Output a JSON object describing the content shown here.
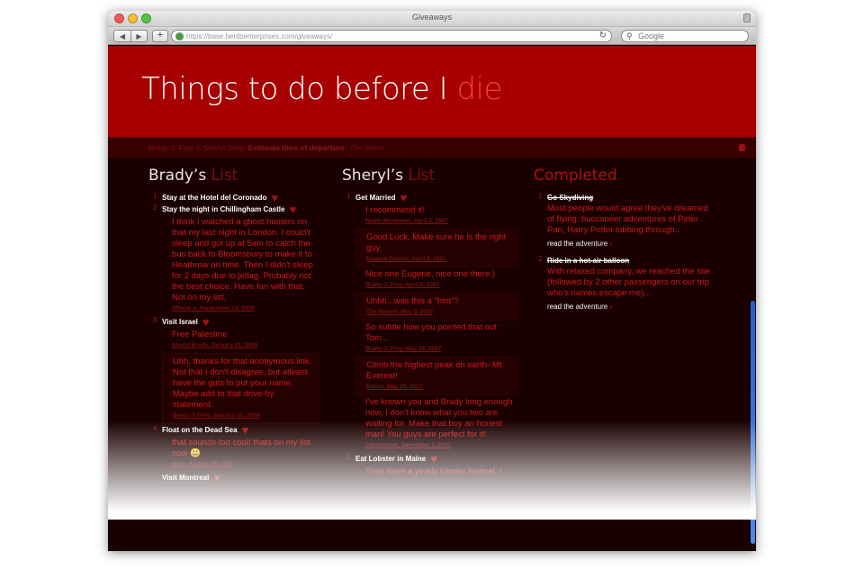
{
  "browser": {
    "window_title": "Giveaways",
    "back": "◀",
    "forward": "▶",
    "add": "+",
    "url": "https://base.bentbenterprises.com/giveaways/",
    "reload": "↻",
    "search_placeholder": "Google"
  },
  "header": {
    "title": "Things to do before I ",
    "title_highlight": "die"
  },
  "subbar": {
    "names": "Brady J. Frey & Sheryl Jang.",
    "label": "Estimate time of departure:",
    "value": "70+ Years"
  },
  "brady": {
    "heading": "Brady’s ",
    "heading_dim": "List",
    "items": [
      {
        "num": "1",
        "title": "Stay at the Hotel del Coronado",
        "comments": []
      },
      {
        "num": "2",
        "title": "Stay the night in Chillingham Castle",
        "comments": [
          {
            "text": "I think I watched a ghost hunters on that my last night in London. I could't sleep and got up at 5am to catch the bus back to Bloomsbury to make it to Heathrow on time. Then I didn't sleep for 2 days due to jetlag. Probably not the best choice. Have fun with that. Not on my list.",
            "meta": "tiffanie o, September 14, 2009",
            "boxed": false
          }
        ]
      },
      {
        "num": "3",
        "title": "Visit Israel",
        "comments": [
          {
            "text": "Free Palestine",
            "meta": "Sheryl Brady, January 31, 2009",
            "boxed": false
          },
          {
            "text": "Uhh, thanks for that anonymous link. Not that I don't disagree, but atleast have the guts to put your name. Maybe add to that drive-by statement.",
            "meta": "Brady J. Frey, January 31, 2009",
            "boxed": true
          }
        ]
      },
      {
        "num": "4",
        "title": "Float on the Dead Sea",
        "comments": [
          {
            "text": "that sounds too cool! thats on my list now 😃",
            "meta": "anna, August 30, 2010",
            "boxed": false
          }
        ]
      },
      {
        "num": "",
        "title": "Visit Montreal",
        "comments": []
      }
    ]
  },
  "sheryl": {
    "heading": "Sheryl’s ",
    "heading_dim": "List",
    "items": [
      {
        "num": "1",
        "title": "Get Married",
        "comments": [
          {
            "text": "I recommend it!",
            "meta": "Noam Birnbaum, April 3, 2007",
            "boxed": false
          },
          {
            "text": "Good Luck, Make sure he is the right guy.",
            "meta": "Eugene Santos, April 4, 2007",
            "boxed": true
          },
          {
            "text": "Nice one Eugene, nice one there.)",
            "meta": "Brady J. Frey, April 5, 2007",
            "boxed": false
          },
          {
            "text": "Uhhh...was this a \"hint\"?",
            "meta": "Tim Nesser, May 5, 2007",
            "boxed": true
          },
          {
            "text": "So subtle how you pointed that out Tom...",
            "meta": "Brady J. Frey, May 18, 2007",
            "boxed": false
          },
          {
            "text": "Climb the highest peak on earth- Mt. Everest!",
            "meta": "Edwin, May 29, 2007",
            "boxed": true
          },
          {
            "text": "I've known you and Brady long enough now, I don't know what you two are waiting for. Make that boy an honest man! You guys are perfect for it!",
            "meta": "Christopher, December 2, 2007",
            "boxed": false
          }
        ]
      },
      {
        "num": "2",
        "title": "Eat Lobster in Maine",
        "comments": [
          {
            "text": "They have a yearly lobster festival. I",
            "meta": "",
            "boxed": false
          }
        ]
      }
    ]
  },
  "completed": {
    "heading": "Completed",
    "items": [
      {
        "num": "1",
        "title": "Go Skydiving",
        "text": "Most people would agree they've dreamed of flying; buccaneer adventures of Peter Pan, Harry Potter lobbing through...",
        "read": "read the",
        "read2": "adventure"
      },
      {
        "num": "2",
        "title": "Ride in a hot-air balloon",
        "text": "With relaxed company, we reached the site (followed by 2 other passengers on our trip who's names escape me)...",
        "read": "read the",
        "read2": "adventure"
      }
    ]
  },
  "colors": {
    "header_red": "#a60000",
    "page_bg": "#1a0000",
    "accent": "#ff3a3a"
  }
}
